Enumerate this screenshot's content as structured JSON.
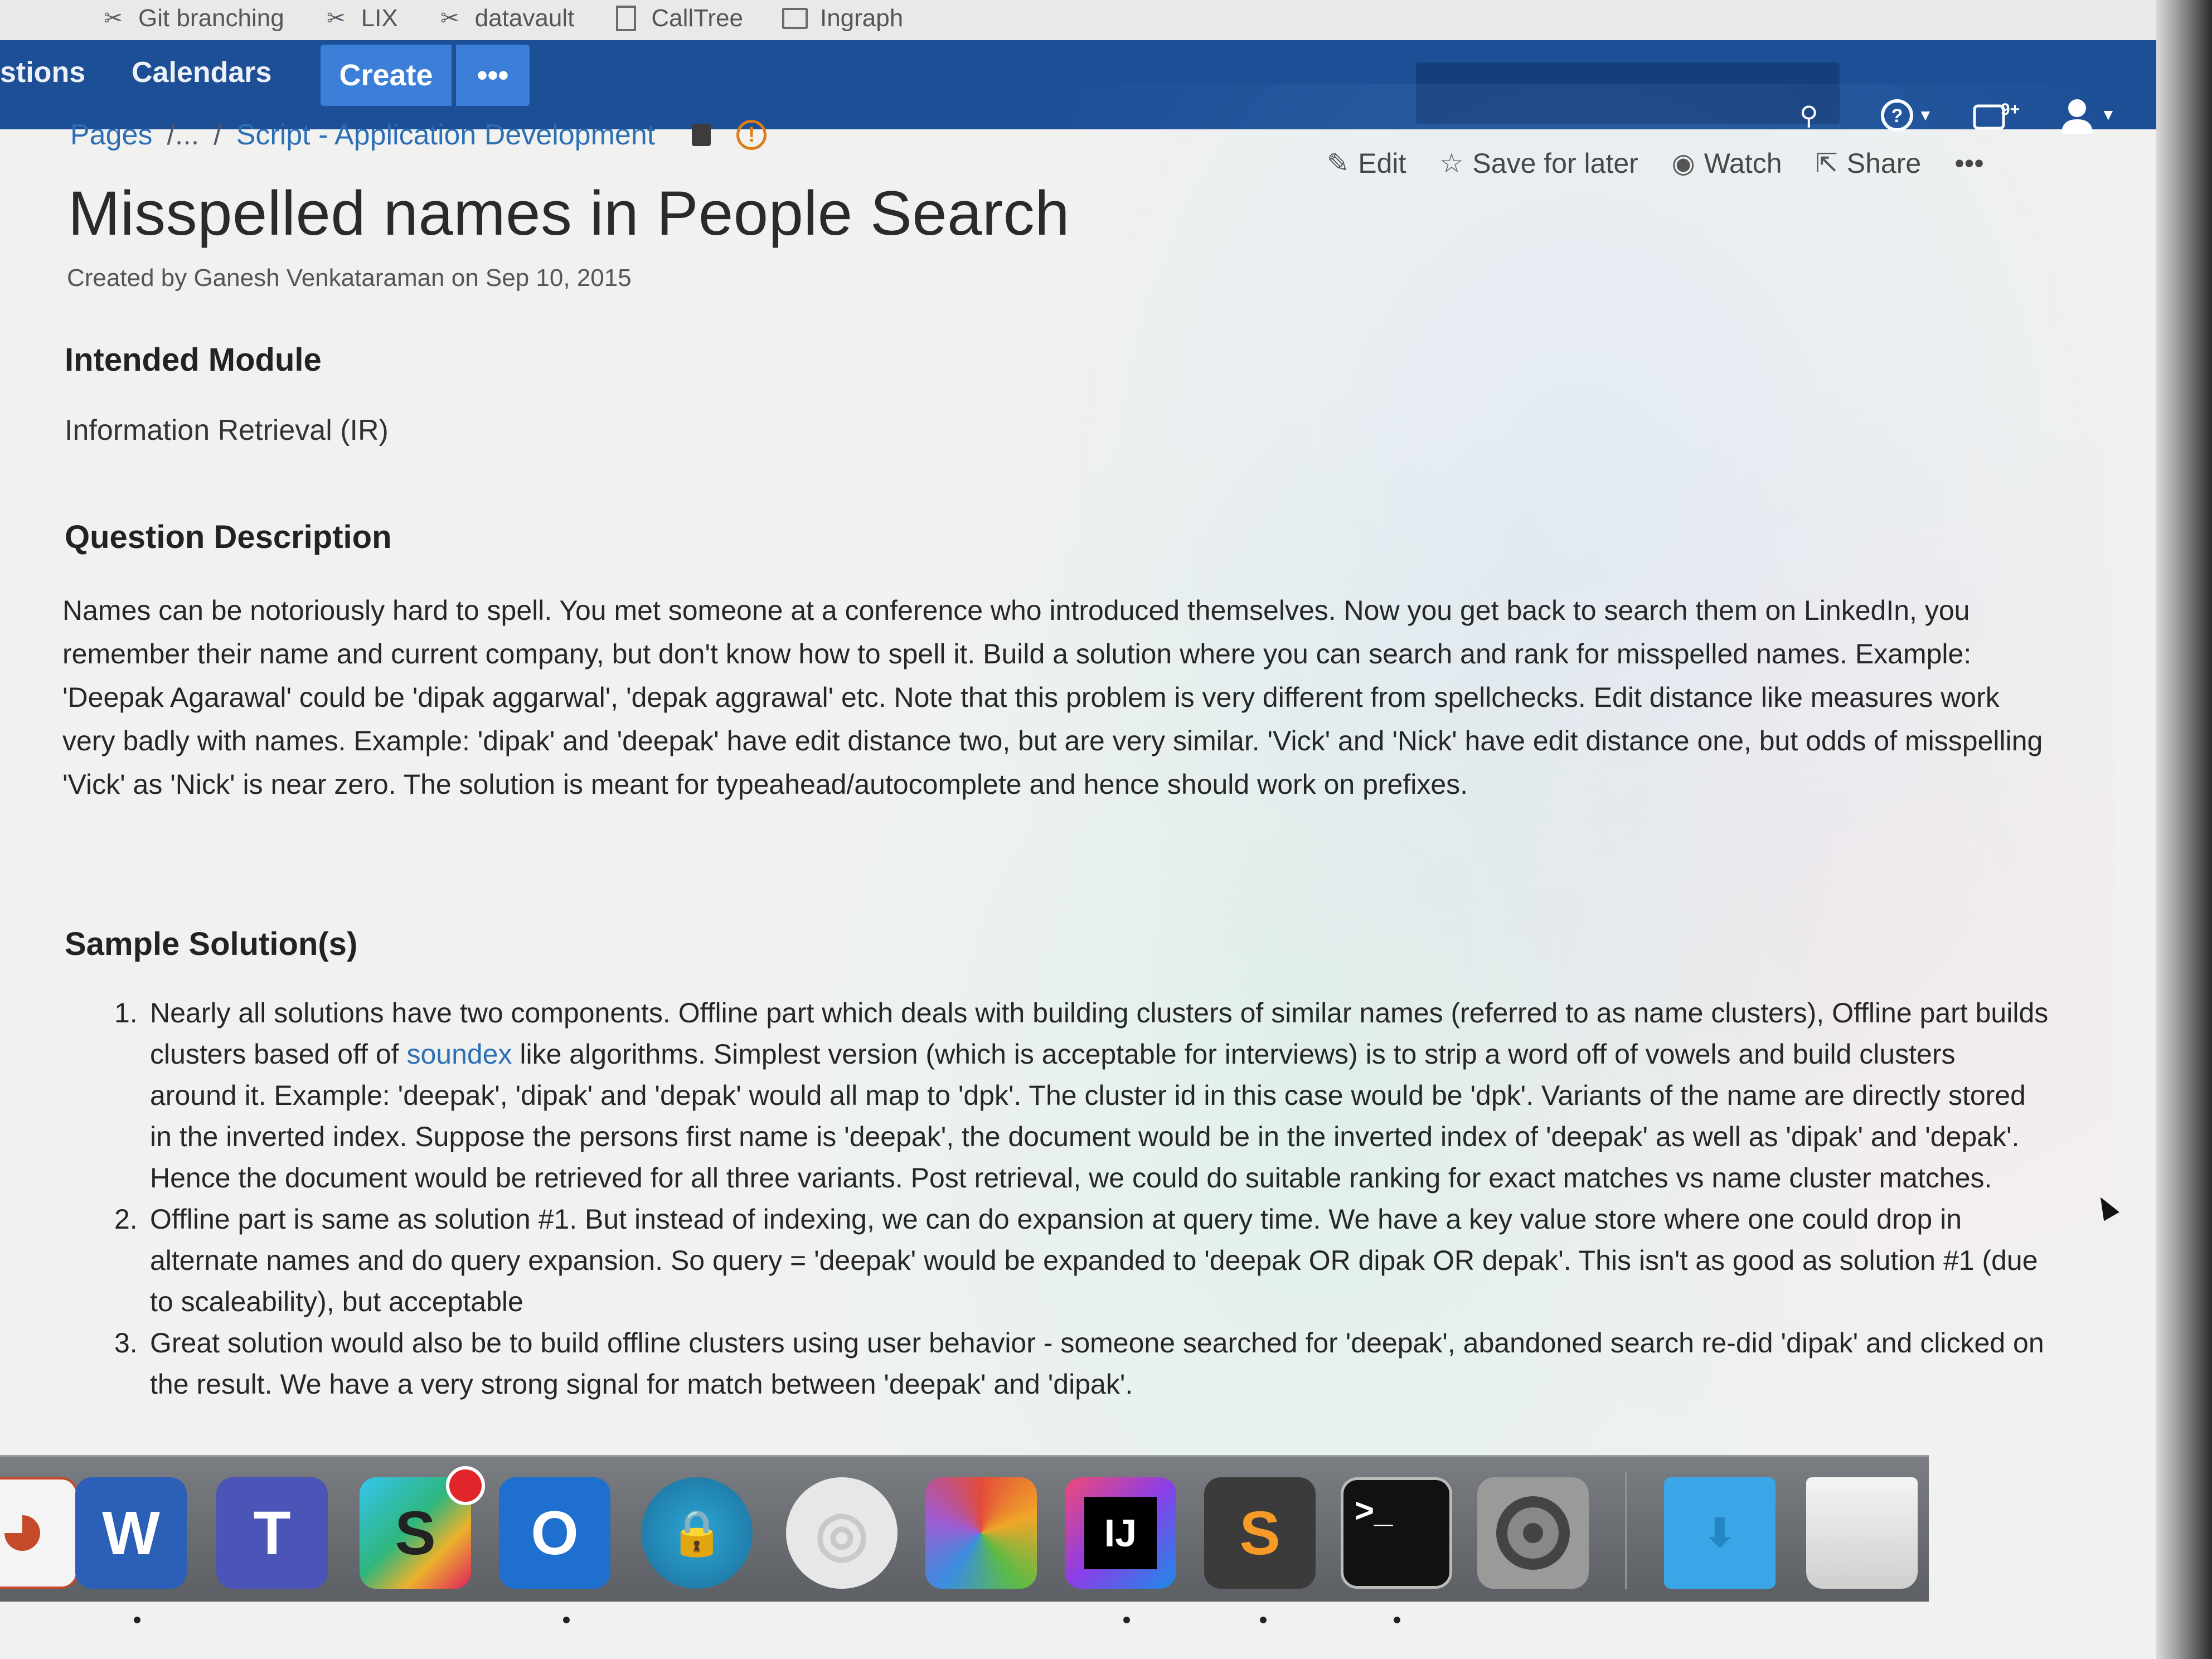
{
  "bookmarks": [
    {
      "label": "Git branching",
      "icon": "tool-icon"
    },
    {
      "label": "LIX",
      "icon": "tool-icon"
    },
    {
      "label": "datavault",
      "icon": "tool-icon"
    },
    {
      "label": "CallTree",
      "icon": "page-icon"
    },
    {
      "label": "Ingraph",
      "icon": "folder-icon"
    }
  ],
  "header": {
    "nav": [
      "stions",
      "Calendars"
    ],
    "create_label": "Create",
    "more_label": "•••"
  },
  "breadcrumb": {
    "pages": "Pages",
    "ellipsis": "/...",
    "sep": "/",
    "current": "Script - Application Development"
  },
  "actions": {
    "edit": "Edit",
    "save_for_later": "Save for later",
    "watch": "Watch",
    "share": "Share",
    "more": "•••"
  },
  "page": {
    "title": "Misspelled names in People Search",
    "byline": "Created by Ganesh Venkataraman on Sep 10, 2015",
    "intended_module_heading": "Intended Module",
    "intended_module_value": "Information Retrieval (IR)",
    "question_heading": "Question Description",
    "question_text": "Names can be notoriously hard to spell. You met someone at a conference who introduced themselves. Now you get back to search them on LinkedIn, you remember their name and current company, but don't know how to spell it. Build a solution where you can search and rank for misspelled names. Example: 'Deepak Agarawal' could be 'dipak aggarwal', 'depak aggrawal' etc. Note that this problem is very different from spellchecks. Edit distance like measures work very badly with names. Example: 'dipak' and 'deepak' have edit distance two, but are very similar. 'Vick' and 'Nick' have edit distance one, but odds of misspelling 'Vick' as 'Nick' is near zero. The solution is meant for typeahead/autocomplete and hence should work on prefixes.",
    "solutions_heading": "Sample Solution(s)",
    "solutions": [
      {
        "num": "1.",
        "before_link": "Nearly all solutions have two components. Offline part which deals with building clusters of similar names (referred to as name clusters), Offline part builds clusters based off of ",
        "link": "soundex",
        "after_link": " like algorithms. Simplest version (which is acceptable for interviews) is to strip a word off of vowels and build clusters around it. Example: 'deepak', 'dipak' and 'depak' would all map to 'dpk'. The cluster id in this case would be 'dpk'. Variants of the name are directly stored in the inverted index. Suppose the persons first name is 'deepak', the document would be in the inverted index of 'deepak' as well as 'dipak' and 'depak'. Hence the document would be retrieved for all three variants. Post retrieval, we could do suitable ranking for exact matches vs name cluster matches."
      },
      {
        "num": "2.",
        "text": "Offline part is same as solution #1. But instead of indexing, we can do expansion at query time. We have a key value store where one could drop in alternate names and do query expansion. So query = 'deepak' would be expanded to 'deepak OR dipak OR depak'. This isn't as good as solution #1 (due to scaleability), but acceptable"
      },
      {
        "num": "3.",
        "text": "Great solution would also be to build offline clusters using user behavior - someone searched for 'deepak', abandoned search re-did 'dipak' and clicked on the result. We have a very strong signal for match between 'deepak' and 'dipak'."
      }
    ]
  },
  "dock": {
    "items": [
      "powerpoint-icon",
      "word-icon",
      "teams-icon",
      "slack-icon",
      "outlook-icon",
      "vpn-icon",
      "wifi-icon",
      "colors-icon",
      "intellij-icon",
      "sublime-icon",
      "terminal-icon",
      "system-preferences-icon",
      "downloads-folder-icon",
      "trash-icon"
    ],
    "letters": {
      "word": "W",
      "teams": "T",
      "slack": "S",
      "outlook": "O",
      "intellij": "IJ",
      "sublime": "S",
      "terminal": ">_"
    }
  },
  "colors": {
    "header_blue": "#1c4f96",
    "create_blue": "#3b7fd8",
    "link_blue": "#2d6fb5",
    "alert_orange": "#e07b18"
  }
}
